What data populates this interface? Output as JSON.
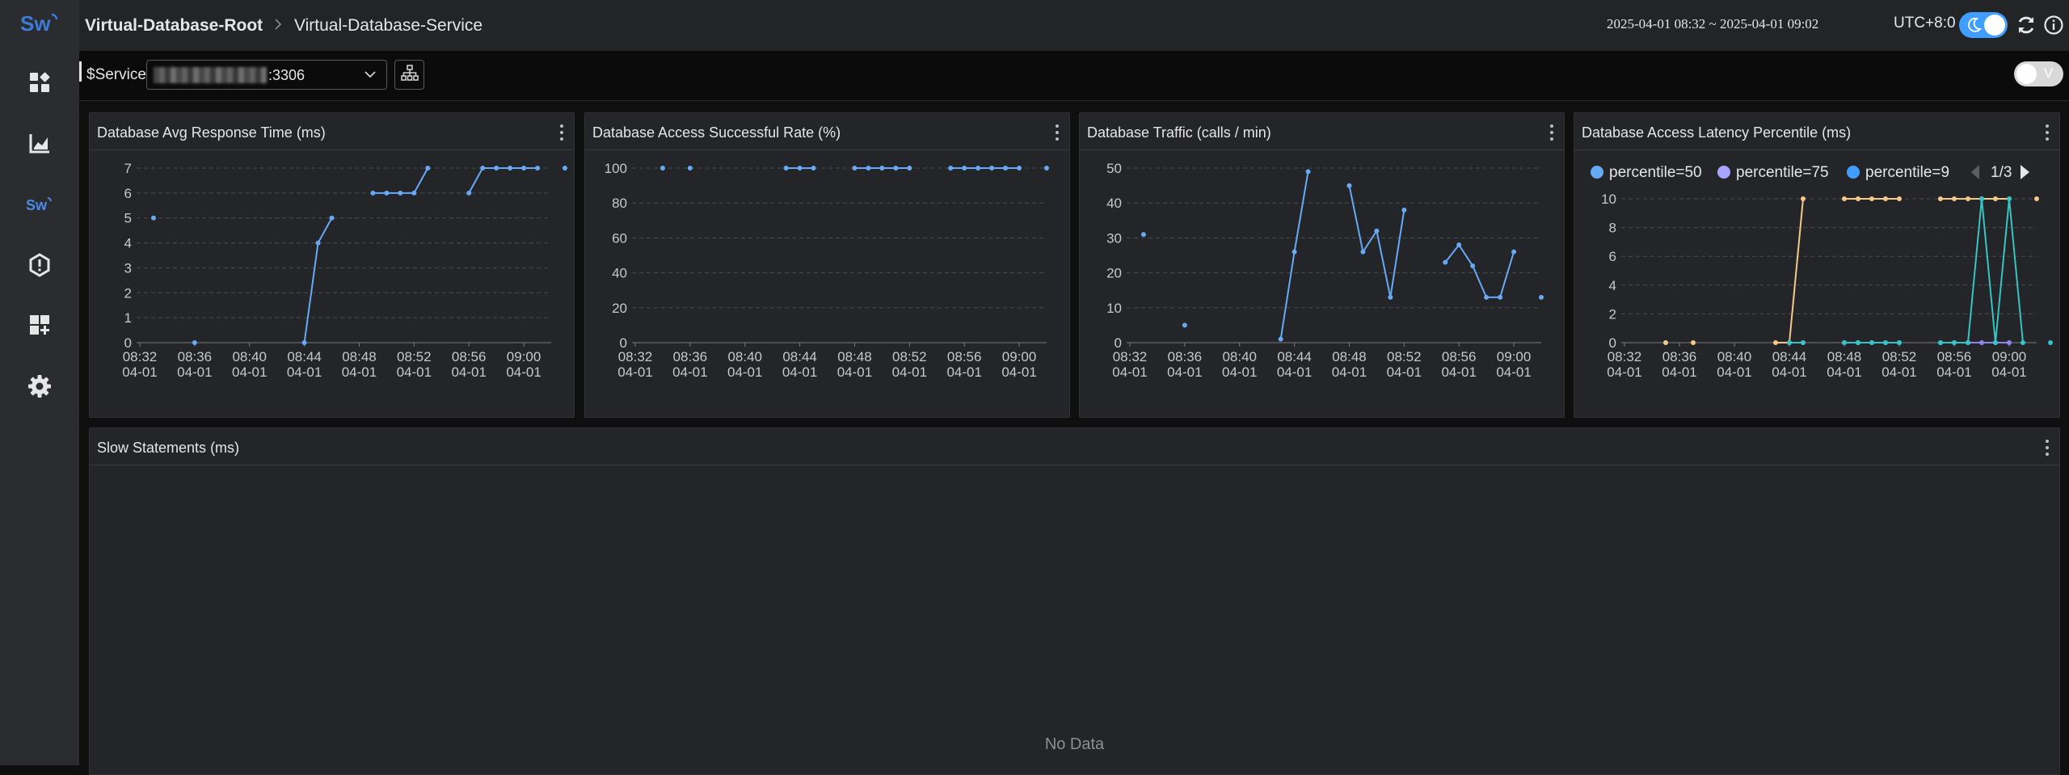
{
  "sidebar": {
    "logo": "Sw",
    "items": [
      "dashboard-icon",
      "metrics-chart-icon",
      "skywalking-icon",
      "alarm-icon",
      "add-dashboard-icon",
      "settings-icon"
    ]
  },
  "header": {
    "breadcrumb_root": "Virtual-Database-Root",
    "breadcrumb_sep": ">",
    "breadcrumb_current": "Virtual-Database-Service",
    "time_range": "2025-04-01 08:32 ~ 2025-04-01 09:02",
    "timezone": "UTC+8:0",
    "accent": "#409eff"
  },
  "toolbar": {
    "service_label": "$Service",
    "service_value": ":3306",
    "v_toggle": "V"
  },
  "panels": {
    "p1_title": "Database Avg Response Time (ms)",
    "p2_title": "Database Access Successful Rate (%)",
    "p3_title": "Database Traffic (calls / min)",
    "p4_title": "Database Access Latency Percentile (ms)",
    "p4_pager": "1/3",
    "slow_title": "Slow Statements (ms)",
    "slow_empty": "No Data"
  },
  "chart_data": [
    {
      "type": "line",
      "title": "Database Avg Response Time (ms)",
      "x": [
        "08:32",
        "08:33",
        "08:34",
        "08:35",
        "08:36",
        "08:37",
        "08:38",
        "08:39",
        "08:40",
        "08:41",
        "08:42",
        "08:43",
        "08:44",
        "08:45",
        "08:46",
        "08:47",
        "08:48",
        "08:49",
        "08:50",
        "08:51",
        "08:52",
        "08:53",
        "08:54",
        "08:55",
        "08:56",
        "08:57",
        "08:58",
        "08:59",
        "09:00",
        "09:01",
        "09:02"
      ],
      "x_tick_labels": [
        "08:32\n04-01",
        "08:36\n04-01",
        "08:40\n04-01",
        "08:44\n04-01",
        "08:48\n04-01",
        "08:52\n04-01",
        "08:56\n04-01",
        "09:00\n04-01"
      ],
      "ylim": [
        0,
        7
      ],
      "yticks": [
        0,
        1,
        2,
        3,
        4,
        5,
        6,
        7
      ],
      "series": [
        {
          "color": "#66aaf5",
          "values": [
            null,
            5,
            null,
            null,
            0,
            null,
            null,
            null,
            null,
            null,
            null,
            null,
            0,
            4,
            5,
            null,
            null,
            6,
            6,
            6,
            6,
            7,
            null,
            null,
            6,
            7,
            7,
            7,
            7,
            7,
            null,
            7
          ]
        }
      ]
    },
    {
      "type": "line",
      "title": "Database Access Successful Rate (%)",
      "x_tick_labels": [
        "08:32\n04-01",
        "08:36\n04-01",
        "08:40\n04-01",
        "08:44\n04-01",
        "08:48\n04-01",
        "08:52\n04-01",
        "08:56\n04-01",
        "09:00\n04-01"
      ],
      "ylim": [
        0,
        100
      ],
      "yticks": [
        0,
        20,
        40,
        60,
        80,
        100
      ],
      "series": [
        {
          "color": "#66aaf5",
          "values": [
            null,
            null,
            100,
            null,
            100,
            null,
            null,
            null,
            null,
            null,
            null,
            100,
            100,
            100,
            null,
            null,
            100,
            100,
            100,
            100,
            100,
            null,
            null,
            100,
            100,
            100,
            100,
            100,
            100,
            null,
            100
          ]
        }
      ]
    },
    {
      "type": "line",
      "title": "Database Traffic (calls / min)",
      "x_tick_labels": [
        "08:32\n04-01",
        "08:36\n04-01",
        "08:40\n04-01",
        "08:44\n04-01",
        "08:48\n04-01",
        "08:52\n04-01",
        "08:56\n04-01",
        "09:00\n04-01"
      ],
      "ylim": [
        0,
        50
      ],
      "yticks": [
        0,
        10,
        20,
        30,
        40,
        50
      ],
      "series": [
        {
          "color": "#66aaf5",
          "values": [
            null,
            31,
            null,
            null,
            5,
            null,
            null,
            null,
            null,
            null,
            null,
            1,
            26,
            49,
            null,
            null,
            45,
            26,
            32,
            13,
            38,
            null,
            null,
            23,
            28,
            22,
            13,
            13,
            26,
            null,
            13
          ]
        }
      ]
    },
    {
      "type": "line",
      "title": "Database Access Latency Percentile (ms)",
      "x_tick_labels": [
        "08:32\n04-01",
        "08:36\n04-01",
        "08:40\n04-01",
        "08:44\n04-01",
        "08:48\n04-01",
        "08:52\n04-01",
        "08:56\n04-01",
        "09:00\n04-01"
      ],
      "ylim": [
        0,
        10
      ],
      "yticks": [
        0,
        2,
        4,
        6,
        8,
        10
      ],
      "legend": [
        "percentile=50",
        "percentile=75",
        "percentile=9"
      ],
      "series": [
        {
          "name": "percentile=50",
          "color": "#f5c98a",
          "values": [
            null,
            null,
            null,
            0,
            null,
            0,
            null,
            null,
            null,
            null,
            null,
            0,
            0,
            10,
            null,
            null,
            10,
            10,
            10,
            10,
            10,
            null,
            null,
            10,
            10,
            10,
            10,
            10,
            10,
            null,
            10
          ]
        },
        {
          "name": "percentile=75",
          "color": "#8f86f2",
          "values": [
            null,
            null,
            null,
            null,
            null,
            null,
            null,
            null,
            null,
            null,
            null,
            null,
            0,
            0,
            null,
            null,
            0,
            0,
            0,
            0,
            0,
            null,
            null,
            0,
            0,
            0,
            0,
            0,
            0,
            null,
            null
          ]
        },
        {
          "name": "percentile=9",
          "color": "#36c4c4",
          "values": [
            null,
            null,
            null,
            null,
            null,
            null,
            null,
            null,
            null,
            null,
            null,
            null,
            0,
            0,
            null,
            null,
            0,
            0,
            0,
            0,
            0,
            null,
            null,
            0,
            0,
            0,
            10,
            0,
            10,
            0,
            null,
            0
          ]
        }
      ],
      "legend_colors": [
        "#66aaf5",
        "#a7a5ff",
        "#409eff"
      ]
    }
  ]
}
